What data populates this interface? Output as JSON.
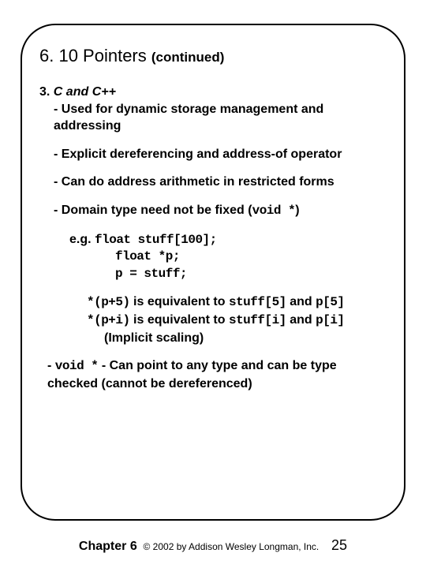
{
  "title": {
    "main": "6. 10 Pointers",
    "sub": "(continued)"
  },
  "section": {
    "num": "3.",
    "label": "C and C++",
    "bullets": [
      "Used for dynamic storage management and addressing",
      "Explicit dereferencing and address-of operator",
      "Can do address arithmetic in restricted forms",
      "Domain type need not be fixed ("
    ],
    "voidstar": "void *",
    "close_paren": ")"
  },
  "example": {
    "lead": "e.g.",
    "lines": [
      "float stuff[100];",
      "float *p;",
      "p = stuff;"
    ]
  },
  "equiv": [
    {
      "lhs": "*(p+5)",
      "mid": " is equivalent to ",
      "rhs1": "stuff[5]",
      "and": " and ",
      "rhs2": "p[5]"
    },
    {
      "lhs": "*(p+i)",
      "mid": " is equivalent to ",
      "rhs1": "stuff[i]",
      "and": " and ",
      "rhs2": "p[i]"
    }
  ],
  "implicit": "(Implicit scaling)",
  "voidnote": {
    "dash": "- ",
    "code": "void *",
    "text": " - Can point to any type and can be type checked (cannot be dereferenced)"
  },
  "footer": {
    "chapter": "Chapter 6",
    "copyright": "© 2002 by Addison Wesley Longman, Inc.",
    "page": "25"
  }
}
